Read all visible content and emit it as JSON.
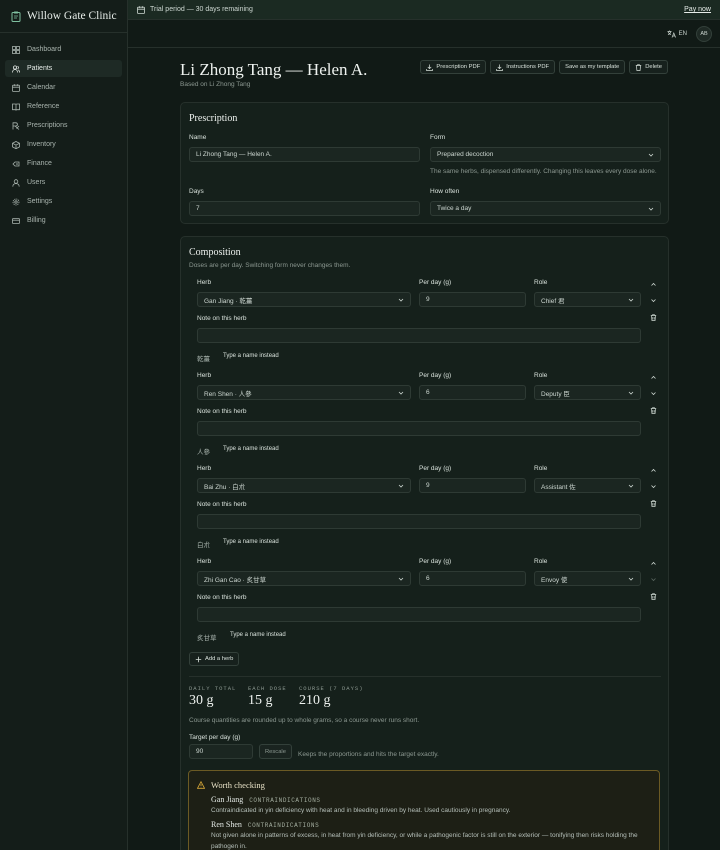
{
  "brand": {
    "name": "Willow Gate Clinic",
    "icon": "clipboard-icon"
  },
  "nav": [
    {
      "label": "Dashboard",
      "icon": "grid-icon",
      "active": false
    },
    {
      "label": "Patients",
      "icon": "users-icon",
      "active": true
    },
    {
      "label": "Calendar",
      "icon": "calendar-icon",
      "active": false
    },
    {
      "label": "Reference",
      "icon": "book-icon",
      "active": false
    },
    {
      "label": "Prescriptions",
      "icon": "prescription-icon",
      "active": false
    },
    {
      "label": "Inventory",
      "icon": "box-icon",
      "active": false
    },
    {
      "label": "Finance",
      "icon": "finance-icon",
      "active": false
    },
    {
      "label": "Users",
      "icon": "user-icon",
      "active": false
    },
    {
      "label": "Settings",
      "icon": "gear-icon",
      "active": false
    },
    {
      "label": "Billing",
      "icon": "card-icon",
      "active": false
    }
  ],
  "trial": {
    "text": "Trial period — 30 days remaining",
    "pay": "Pay now"
  },
  "header": {
    "lang": "EN",
    "avatar": "AB"
  },
  "page": {
    "title": "Li Zhong Tang — Helen A.",
    "subtitle": "Based on Li Zhong Tang",
    "actions": {
      "prescription_pdf": "Prescription PDF",
      "instructions_pdf": "Instructions PDF",
      "save_template": "Save as my template",
      "delete": "Delete"
    }
  },
  "prescription": {
    "title": "Prescription",
    "name_label": "Name",
    "name_value": "Li Zhong Tang — Helen A.",
    "form_label": "Form",
    "form_value": "Prepared decoction",
    "form_hint": "The same herbs, dispensed differently. Changing this leaves every dose alone.",
    "days_label": "Days",
    "days_value": "7",
    "often_label": "How often",
    "often_value": "Twice a day"
  },
  "composition": {
    "title": "Composition",
    "subtitle": "Doses are per day. Switching form never changes them.",
    "herb_label": "Herb",
    "per_day_label": "Per day (g)",
    "role_label": "Role",
    "note_label": "Note on this herb",
    "type_name": "Type a name instead",
    "herbs": [
      {
        "herb": "Gan Jiang · 乾薑",
        "per_day": "9",
        "role": "Chief 君",
        "chinese": "乾薑",
        "note": ""
      },
      {
        "herb": "Ren Shen · 人參",
        "per_day": "6",
        "role": "Deputy 臣",
        "chinese": "人參",
        "note": ""
      },
      {
        "herb": "Bai Zhu · 白朮",
        "per_day": "9",
        "role": "Assistant 佐",
        "chinese": "白朮",
        "note": ""
      },
      {
        "herb": "Zhi Gan Cao · 炙甘草",
        "per_day": "6",
        "role": "Envoy 使",
        "chinese": "炙甘草",
        "note": ""
      }
    ],
    "add_herb": "Add a herb"
  },
  "totals": {
    "daily_label": "DAILY TOTAL",
    "daily_value": "30 g",
    "dose_label": "EACH DOSE",
    "dose_value": "15 g",
    "course_label": "COURSE (7 DAYS)",
    "course_value": "210 g",
    "rounding_note": "Course quantities are rounded up to whole grams, so a course never runs short.",
    "target_label": "Target per day (g)",
    "target_value": "90",
    "rescale": "Rescale",
    "rescale_hint": "Keeps the proportions and hits the target exactly."
  },
  "warnings": {
    "title": "Worth checking",
    "items": [
      {
        "herb": "Gan Jiang",
        "tag": "CONTRAINDICATIONS",
        "text": "Contraindicated in yin deficiency with heat and in bleeding driven by heat. Used cautiously in pregnancy."
      },
      {
        "herb": "Ren Shen",
        "tag": "CONTRAINDICATIONS",
        "text": "Not given alone in patterns of excess, in heat from yin deficiency, or while a pathogenic factor is still on the exterior — tonifying then risks holding the pathogen in."
      }
    ]
  },
  "colors": {
    "background": "#111a16",
    "card": "#15201b",
    "warning_border": "#6b5a24"
  }
}
